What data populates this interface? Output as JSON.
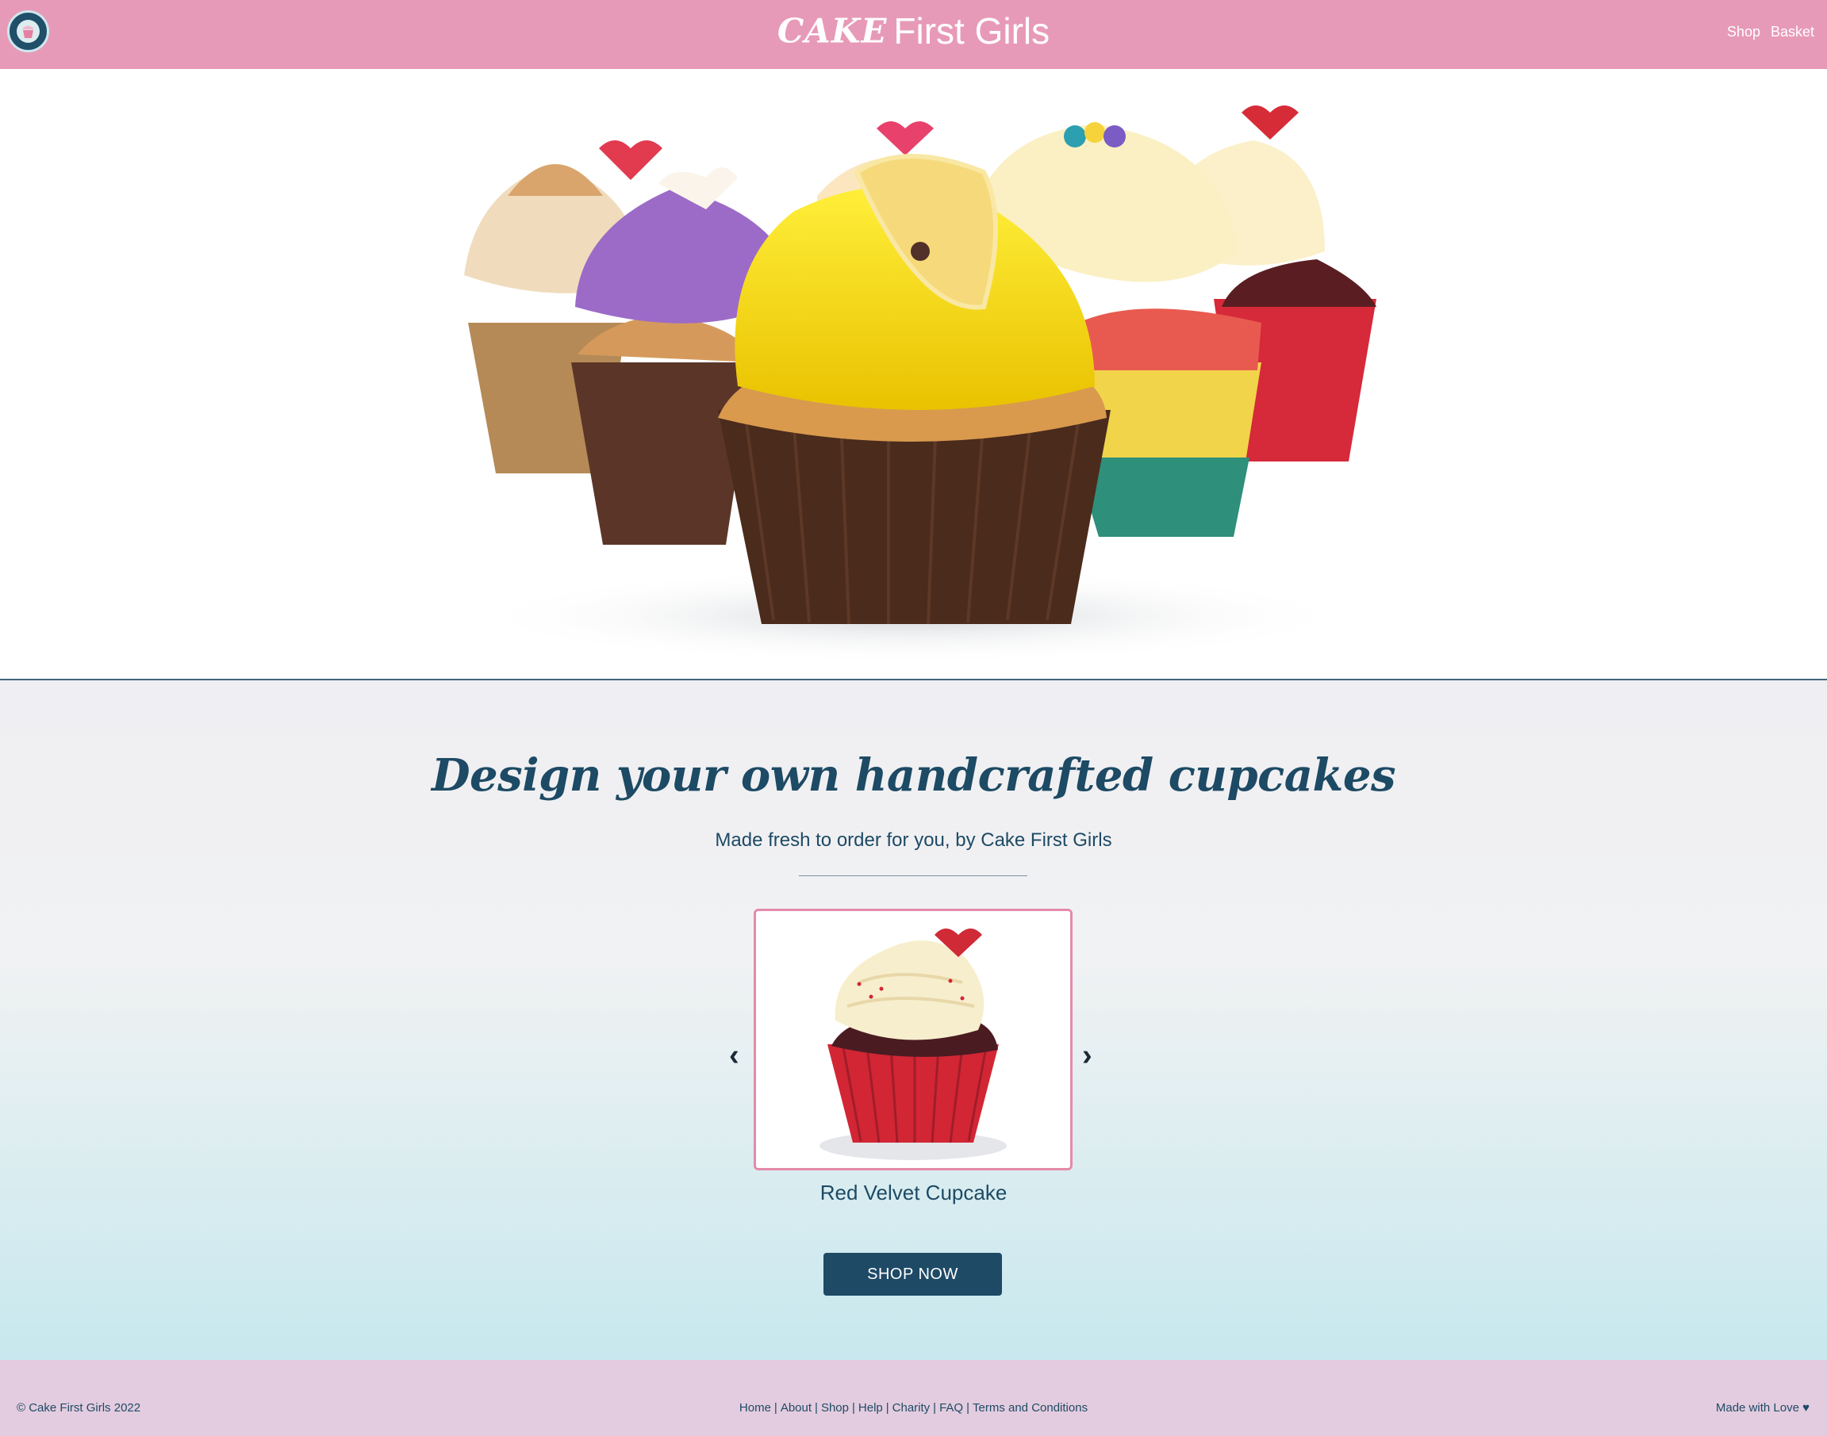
{
  "header": {
    "brand_script": "CAKE",
    "brand_name": "First Girls",
    "nav": [
      "Shop",
      "Basket"
    ]
  },
  "main": {
    "title": "Design your own handcrafted cupcakes",
    "subtitle": "Made fresh to order for you, by Cake First Girls",
    "carousel": {
      "prev": "‹",
      "next": "›",
      "product": "Red Velvet Cupcake"
    },
    "cta": "SHOP NOW"
  },
  "footer": {
    "copyright": "© Cake First Girls 2022",
    "links": [
      "Home",
      "About",
      "Shop",
      "Help",
      "Charity",
      "FAQ",
      "Terms and Conditions"
    ],
    "separator": "|",
    "made_with": "Made with Love ♥"
  },
  "colors": {
    "header_bg": "#e79ab7",
    "primary": "#1e4a66",
    "footer_bg": "#e3ccdf",
    "carousel_border": "#e68aa9"
  }
}
